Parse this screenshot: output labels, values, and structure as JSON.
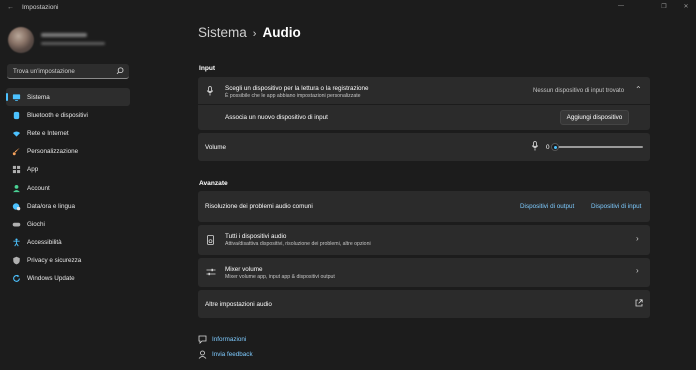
{
  "window": {
    "title": "Impostazioni",
    "back_glyph": "←",
    "controls": [
      "—",
      "❐",
      "✕"
    ]
  },
  "search": {
    "placeholder": "Trova un'impostazione"
  },
  "sidebar": {
    "items": [
      {
        "label": "Sistema",
        "icon": "monitor-icon",
        "color": "#4cc2ff",
        "active": true
      },
      {
        "label": "Bluetooth e dispositivi",
        "icon": "bluetooth-icon",
        "color": "#4cc2ff"
      },
      {
        "label": "Rete e Internet",
        "icon": "wifi-icon",
        "color": "#4cc2ff"
      },
      {
        "label": "Personalizzazione",
        "icon": "brush-icon",
        "color": "#f7a35c"
      },
      {
        "label": "App",
        "icon": "apps-icon",
        "color": "#a0a0a0"
      },
      {
        "label": "Account",
        "icon": "account-icon",
        "color": "#4ad295"
      },
      {
        "label": "Data/ora e lingua",
        "icon": "globe-clock-icon",
        "color": "#4cc2ff"
      },
      {
        "label": "Giochi",
        "icon": "gamepad-icon",
        "color": "#a0a0a0"
      },
      {
        "label": "Accessibilità",
        "icon": "accessibility-icon",
        "color": "#4cc2ff"
      },
      {
        "label": "Privacy e sicurezza",
        "icon": "shield-icon",
        "color": "#a0a0a0"
      },
      {
        "label": "Windows Update",
        "icon": "update-icon",
        "color": "#4cc2ff"
      }
    ]
  },
  "breadcrumb": {
    "parent": "Sistema",
    "separator": "›",
    "current": "Audio"
  },
  "input": {
    "section_title": "Input",
    "choose_title": "Scegli un dispositivo per la lettura o la registrazione",
    "choose_sub": "È possibile che le app abbiano impostazioni personalizzate",
    "choose_status": "Nessun dispositivo di input trovato",
    "pair_label": "Associa un nuovo dispositivo di input",
    "add_button": "Aggiungi dispositivo",
    "volume_label": "Volume",
    "volume_value": "0"
  },
  "advanced": {
    "section_title": "Avanzate",
    "troubleshoot_label": "Risoluzione dei problemi audio comuni",
    "output_link": "Dispositivi di output",
    "input_link": "Dispositivi di input",
    "all_devices_title": "Tutti i dispositivi audio",
    "all_devices_sub": "Attiva/disattiva dispositivi, risoluzione dei problemi, altre opzioni",
    "mixer_title": "Mixer volume",
    "mixer_sub": "Mixer volume app, input app & dispositivi output",
    "more_settings": "Altre impostazioni audio"
  },
  "footer": {
    "info": "Informazioni",
    "feedback": "Invia feedback"
  },
  "colors": {
    "accent": "#4cc2ff",
    "link": "#7ecbff",
    "card": "#2b2b2b",
    "background": "#1c1c1c"
  }
}
